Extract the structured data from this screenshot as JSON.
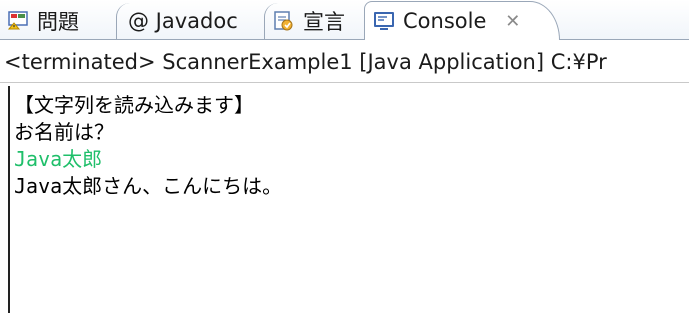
{
  "tabs": [
    {
      "label": "問題",
      "icon": "problems-icon"
    },
    {
      "label": "@ Javadoc",
      "icon": "javadoc-icon"
    },
    {
      "label": "宣言",
      "icon": "declaration-icon"
    },
    {
      "label": "Console",
      "icon": "console-icon",
      "active": true
    }
  ],
  "close_glyph": "✕",
  "status_line": "<terminated> ScannerExample1 [Java Application] C:¥Pr",
  "console": {
    "lines": [
      {
        "text": "【文字列を読み込みます】",
        "kind": "output"
      },
      {
        "text": "お名前は？",
        "kind": "output"
      },
      {
        "text": "Java太郎",
        "kind": "input"
      },
      {
        "text": "Java太郎さん、こんにちは。",
        "kind": "output"
      }
    ]
  },
  "colors": {
    "input_text": "#1fbf6a",
    "border": "#9aa7b8"
  }
}
